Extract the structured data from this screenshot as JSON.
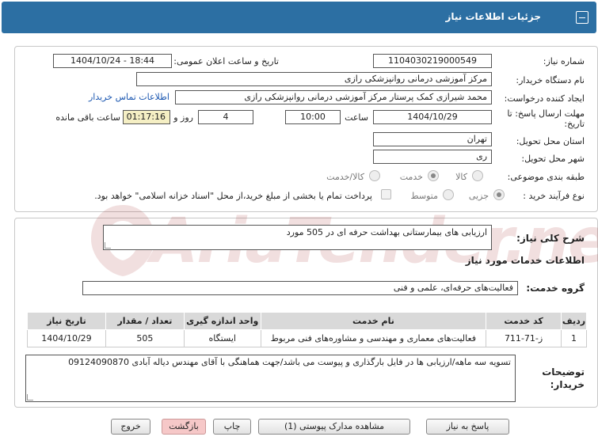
{
  "header": {
    "title": "جزئیات اطلاعات نیاز"
  },
  "form": {
    "need_number_label": "شماره نیاز:",
    "need_number": "1104030219000549",
    "announce_label": "تاریخ و ساعت اعلان عمومی:",
    "announce_value": "1404/10/24 - 18:44",
    "buyer_org_label": "نام دستگاه خریدار:",
    "buyer_org": "مرکز آموزشی درمانی روانپزشکی رازی",
    "creator_label": "ایجاد کننده درخواست:",
    "creator": "محمد شیرازی کمک پرستار مرکز آموزشی درمانی روانپزشکی رازی",
    "contact_link": "اطلاعات تماس خریدار",
    "deadline_label_1": "مهلت ارسال پاسخ: تا",
    "deadline_label_2": "تاریخ:",
    "deadline_date": "1404/10/29",
    "time_label": "ساعت",
    "deadline_time": "10:00",
    "days_value": "4",
    "days_label": "روز و",
    "remaining_time": "01:17:16",
    "remaining_label": "ساعت باقی مانده",
    "province_label": "استان محل تحویل:",
    "province": "تهران",
    "city_label": "شهر محل تحویل:",
    "city": "ری",
    "category_label": "طبقه بندی موضوعی:",
    "category_options": [
      "کالا",
      "خدمت",
      "کالا/خدمت"
    ],
    "process_label": "نوع فرآیند خرید :",
    "process_options": [
      "جزیی",
      "متوسط"
    ],
    "payment_note": "پرداخت تمام یا بخشی از مبلغ خرید،از محل \"اسناد خزانه اسلامی\" خواهد بود."
  },
  "details": {
    "summary_label": "شرح کلی نیاز:",
    "summary": "ارزیابی های بیمارستانی بهداشت حرفه ای در 505 مورد",
    "services_heading": "اطلاعات خدمات مورد نیاز",
    "service_group_label": "گروه خدمت:",
    "service_group": "فعالیت‌های حرفه‌ای، علمی و فنی",
    "table": {
      "headers": [
        "ردیف",
        "کد خدمت",
        "نام خدمت",
        "واحد اندازه گیری",
        "تعداد / مقدار",
        "تاریخ نیاز"
      ],
      "rows": [
        [
          "1",
          "ز-71-711",
          "فعالیت‌های معماری و مهندسی و مشاوره‌های فنی مربوط",
          "ایستگاه",
          "505",
          "1404/10/29"
        ]
      ]
    },
    "buyer_notes_label_1": "توضیحات",
    "buyer_notes_label_2": "خریدار:",
    "buyer_notes": "تسویه سه ماهه/ارزیابی ها در فایل بارگذاری و پیوست می باشد/جهت هماهنگی با آقای مهندس دیاله آبادی 09124090870"
  },
  "buttons": {
    "reply": "پاسخ به نیاز",
    "attachments": "مشاهده مدارک پیوستی (1)",
    "print": "چاپ",
    "back": "بازگشت",
    "exit": "خروج"
  },
  "watermark": "AriaTender.neT",
  "colors": {
    "header_bg": "#2c6fa3",
    "link": "#1a56b0",
    "remaining_bg": "#f5efc4",
    "exit_bg": "#f6c8c8"
  }
}
